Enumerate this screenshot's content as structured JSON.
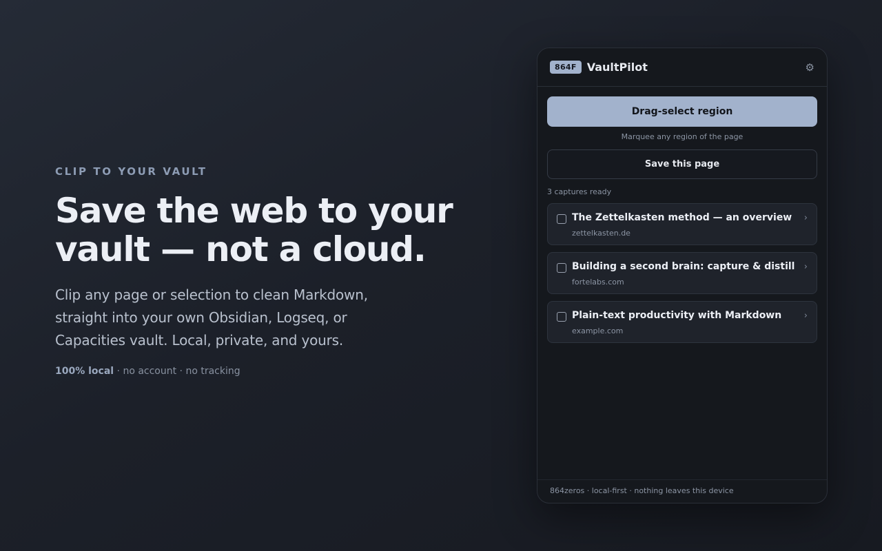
{
  "hero": {
    "eyebrow": "CLIP TO YOUR VAULT",
    "headline": "Save the web to your vault — not a cloud.",
    "subtext": "Clip any page or selection to clean Markdown, straight into your own Obsidian, Logseq, or Capacities vault. Local, private, and yours.",
    "meta_strong": "100% local",
    "meta_rest": " · no account · no tracking"
  },
  "panel": {
    "badge": "864F",
    "app_name": "VaultPilot",
    "settings_icon": "gear-icon",
    "primary_button": "Drag-select region",
    "hint": "Marquee any region of the page",
    "secondary_button": "Save this page",
    "count_text": "3 captures ready",
    "captures": [
      {
        "title": "The Zettelkasten method — an overview",
        "domain": "zettelkasten.de",
        "checked": false
      },
      {
        "title": "Building a second brain: capture & distill",
        "domain": "fortelabs.com",
        "checked": false
      },
      {
        "title": "Plain-text productivity with Markdown",
        "domain": "example.com",
        "checked": false
      }
    ],
    "footer": "864zeros · local-first · nothing leaves this device"
  },
  "colors": {
    "accent": "#a2b2cc",
    "background": "#1c2029",
    "panel": "#15181d"
  }
}
